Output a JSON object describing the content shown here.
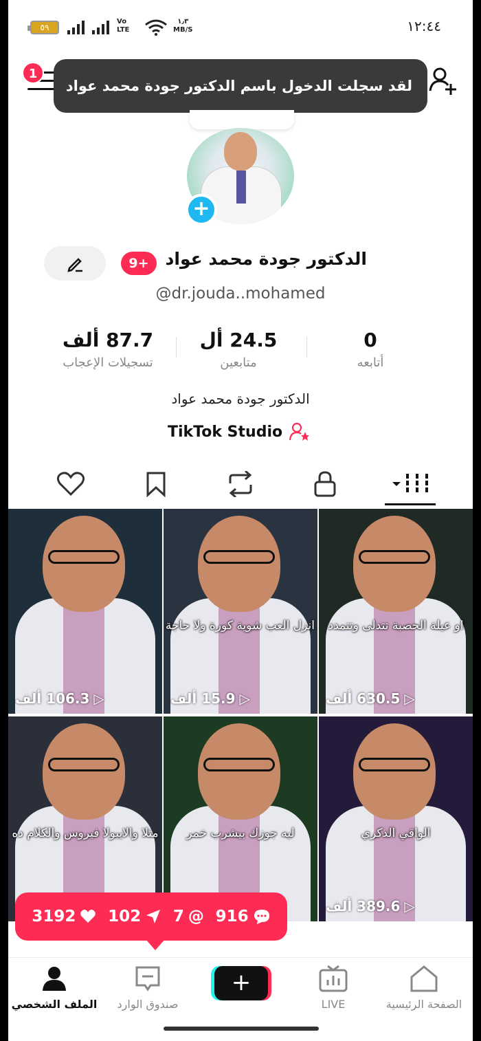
{
  "status_bar": {
    "time": "١٢:٤٤",
    "battery": "٥٩",
    "network_top": "Vo",
    "network_bottom": "LTE",
    "speed_top": "١٫٣",
    "speed_bottom": "MB/S"
  },
  "header": {
    "notification_count": "1",
    "toast": "لقد سجلت الدخول باسم الدكتور جودة محمد عواد"
  },
  "profile": {
    "display_name": "الدكتور جودة محمد عواد",
    "badge": "9+",
    "username": "@dr.jouda..mohamed",
    "bio": "الدكتور جودة محمد عواد",
    "studio": "TikTok Studio"
  },
  "stats": {
    "likes": {
      "value": "87.7 ألف",
      "label": "تسجيلات الإعجاب"
    },
    "followers": {
      "value": "24.5 أل",
      "label": "متابعين"
    },
    "following": {
      "value": "0",
      "label": "أتابعه"
    }
  },
  "tabs": [
    "videos",
    "private",
    "reposts",
    "favorites",
    "liked"
  ],
  "videos": [
    {
      "views": "630.5 ألف",
      "caption": "او عيلة الحصبة تتدلى وتتمدد",
      "bg": "#1f2a24"
    },
    {
      "views": "15.9 ألف",
      "caption": "انزل العب شوية كورة ولا حاجة",
      "bg": "#2a3340"
    },
    {
      "views": "106.3 ألف",
      "caption": "",
      "bg": "#1e2e3a"
    },
    {
      "views": "389.6 ألف",
      "caption": "الواقي الذكري",
      "bg": "#241a3a"
    },
    {
      "views": "",
      "caption": "ليه جوزك بيشرب خمر",
      "bg": "#1d3a22"
    },
    {
      "views": "",
      "caption": "مثلا والايبولا فيروس والكلام ده",
      "bg": "#2a2f3a"
    }
  ],
  "activity": {
    "comments": "916",
    "mentions": "7",
    "shares": "102",
    "likes": "3192"
  },
  "bottom_nav": {
    "home": "الصفحة الرئيسية",
    "live": "LIVE",
    "inbox": "صندوق الوارد",
    "profile": "الملف الشخصي"
  },
  "colors": {
    "accent": "#fe2c55",
    "cyan": "#25f4ee",
    "blue": "#20b8f0"
  }
}
